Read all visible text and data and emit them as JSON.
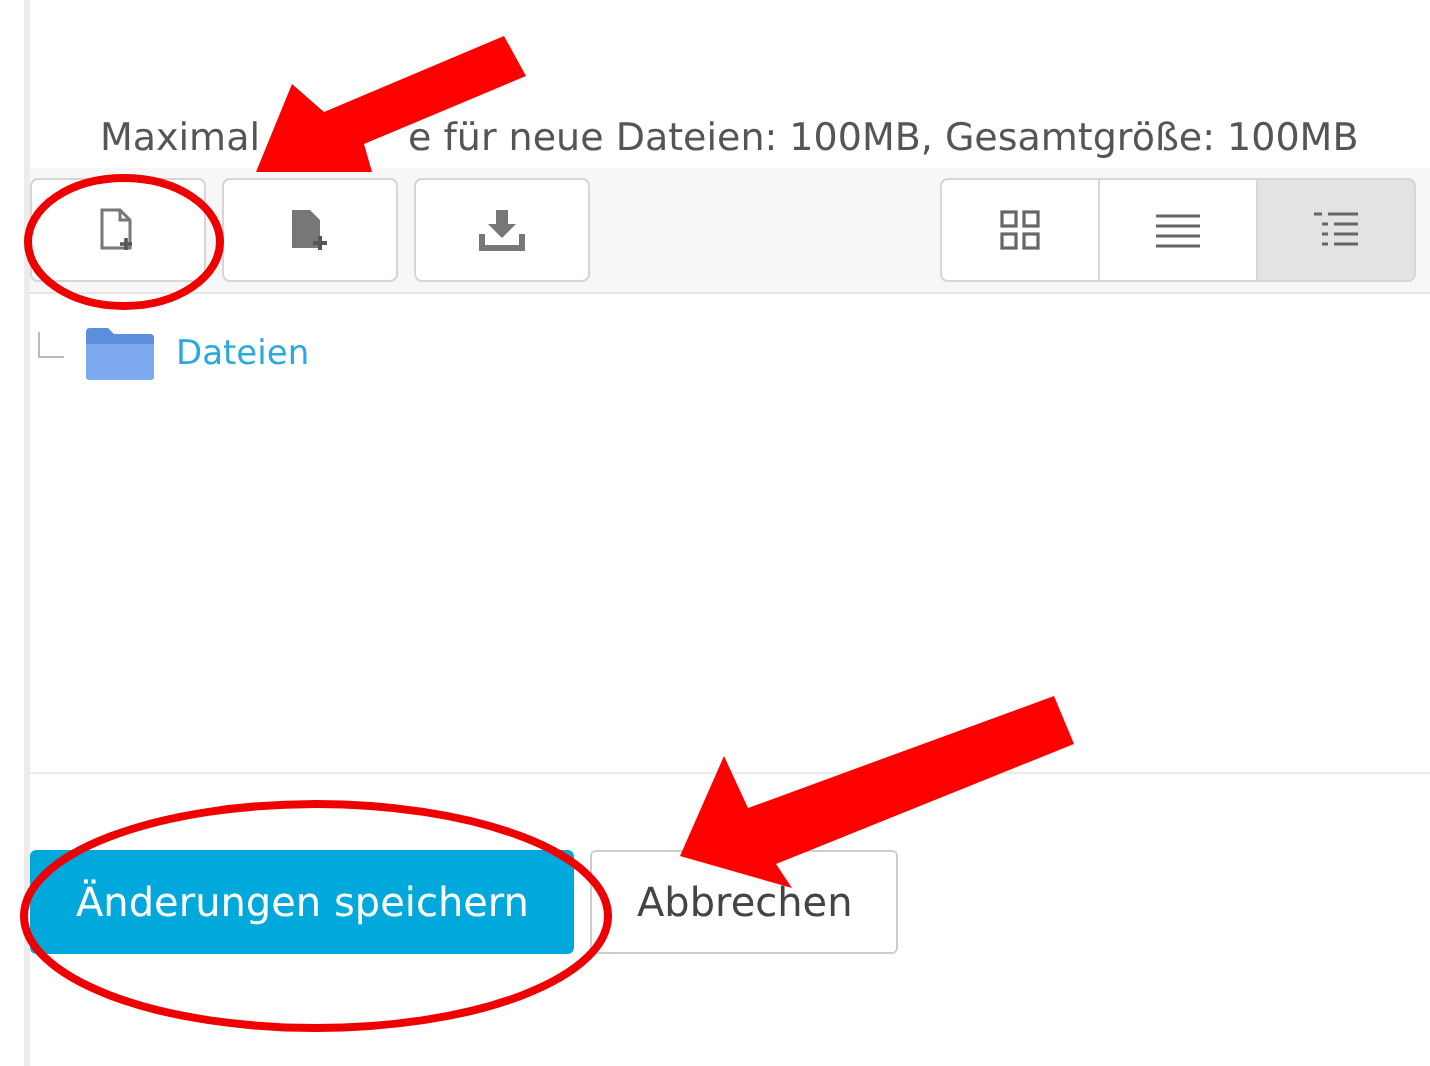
{
  "limits_text": {
    "before_arrow": "Maximal",
    "after_arrow": "e für neue Dateien: 100MB, Gesamtgröße: 100MB"
  },
  "view_modes": [
    {
      "kind": "icons",
      "selected": false
    },
    {
      "kind": "list",
      "selected": false
    },
    {
      "kind": "tree",
      "selected": true
    }
  ],
  "tree": [
    {
      "label": "Dateien"
    }
  ],
  "buttons": [
    {
      "label": "Änderungen speichern",
      "kind": "primary"
    },
    {
      "label": "Abbrechen",
      "kind": "secondary"
    }
  ],
  "annotations": [
    {
      "kind": "ellipse"
    },
    {
      "kind": "arrow"
    },
    {
      "kind": "ellipse"
    },
    {
      "kind": "arrow"
    }
  ]
}
